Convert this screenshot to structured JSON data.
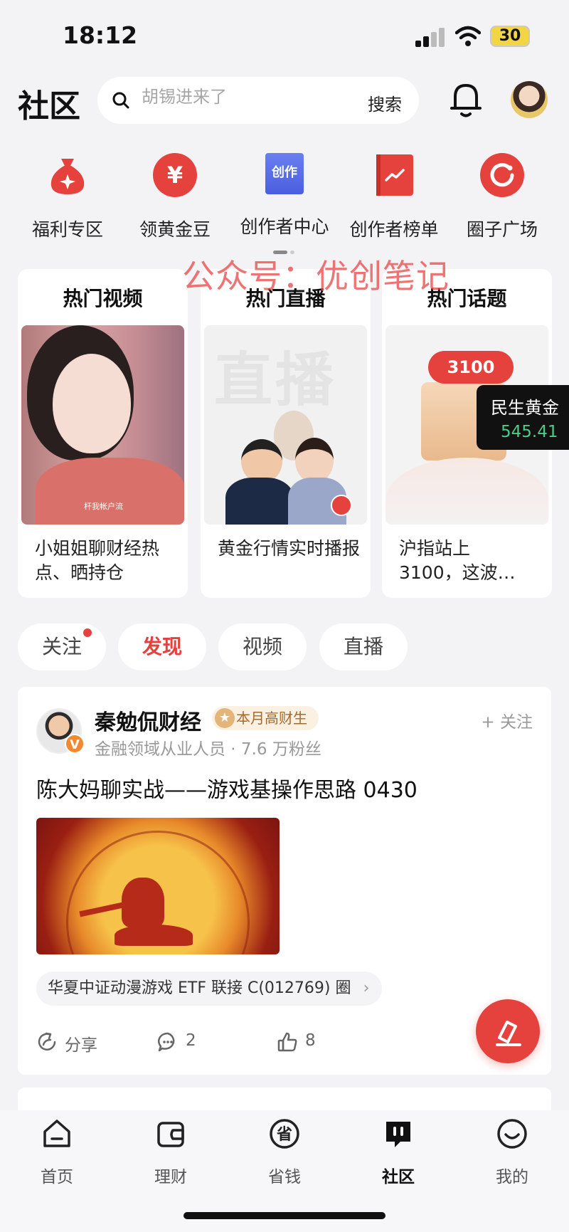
{
  "status_bar": {
    "time": "18:12",
    "battery": "30"
  },
  "header": {
    "title": "社区",
    "search_placeholder": "胡锡进来了",
    "search_button": "搜索"
  },
  "quick_actions": [
    {
      "label": "福利专区",
      "icon": "gift-bag-icon"
    },
    {
      "label": "领黄金豆",
      "icon": "yen-coin-icon"
    },
    {
      "label": "创作者中心",
      "icon": "creator-book-icon",
      "icon_text": "创作"
    },
    {
      "label": "创作者榜单",
      "icon": "ranking-book-icon"
    },
    {
      "label": "圈子广场",
      "icon": "circle-plaza-icon"
    }
  ],
  "watermark": "公众号：优创笔记",
  "hot_sections": [
    {
      "title": "热门视频",
      "text": "小姐姐聊财经热点、晒持仓",
      "caption": "杆我帐户流"
    },
    {
      "title": "热门直播",
      "text": "黄金行情实时播报",
      "bg_text": "直播"
    },
    {
      "title": "热门话题",
      "text": "沪指站上3100，这波…",
      "bubble": "3100"
    }
  ],
  "ticker": {
    "name": "民生黄金",
    "value": "545.41"
  },
  "feed_tabs": [
    {
      "label": "关注",
      "active": false
    },
    {
      "label": "发现",
      "active": true
    },
    {
      "label": "视频",
      "active": false
    },
    {
      "label": "直播",
      "active": false
    }
  ],
  "post": {
    "author": "秦勉侃财经",
    "badge": "本月高财生",
    "meta": "金融领域从业人员 · 7.6 万粉丝",
    "follow": "+ 关注",
    "title": "陈大妈聊实战——游戏基操作思路 0430",
    "fund_tag": "华夏中证动漫游戏 ETF 联接 C(012769) 圈",
    "actions": {
      "share": "分享",
      "comments": "2",
      "likes": "8"
    }
  },
  "tabbar": [
    {
      "label": "首页",
      "icon": "home-icon",
      "active": false
    },
    {
      "label": "理财",
      "icon": "wallet-icon",
      "active": false
    },
    {
      "label": "省钱",
      "icon": "save-money-icon",
      "active": false
    },
    {
      "label": "社区",
      "icon": "community-icon",
      "active": true
    },
    {
      "label": "我的",
      "icon": "profile-icon",
      "active": false
    }
  ],
  "colors": {
    "accent": "#e5423d",
    "background": "#f3f3f6",
    "ticker_up": "#4bcb8c"
  }
}
